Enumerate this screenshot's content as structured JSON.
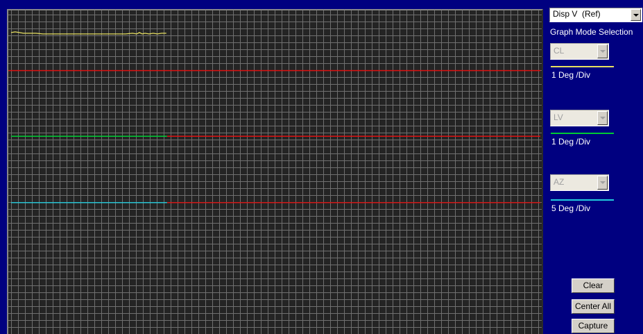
{
  "colors": {
    "background": "#000080",
    "plot_background": "#242424",
    "grid": "#707070",
    "trace_cl": "#e8e060",
    "trace_lv": "#00cc33",
    "trace_az": "#22ccdd",
    "reference": "#dd1111"
  },
  "display_select": {
    "value": "Disp V  (Ref)"
  },
  "graph_mode": {
    "title": "Graph Mode Selection",
    "channels": [
      {
        "name": "CL",
        "scale": "1 Deg /Div",
        "color": "#e8e060"
      },
      {
        "name": "LV",
        "scale": "1 Deg /Div",
        "color": "#00cc33"
      },
      {
        "name": "AZ",
        "scale": "5 Deg /Div",
        "color": "#22ccdd"
      }
    ]
  },
  "buttons": {
    "clear": "Clear",
    "center_all": "Center All",
    "capture": "Capture"
  }
}
